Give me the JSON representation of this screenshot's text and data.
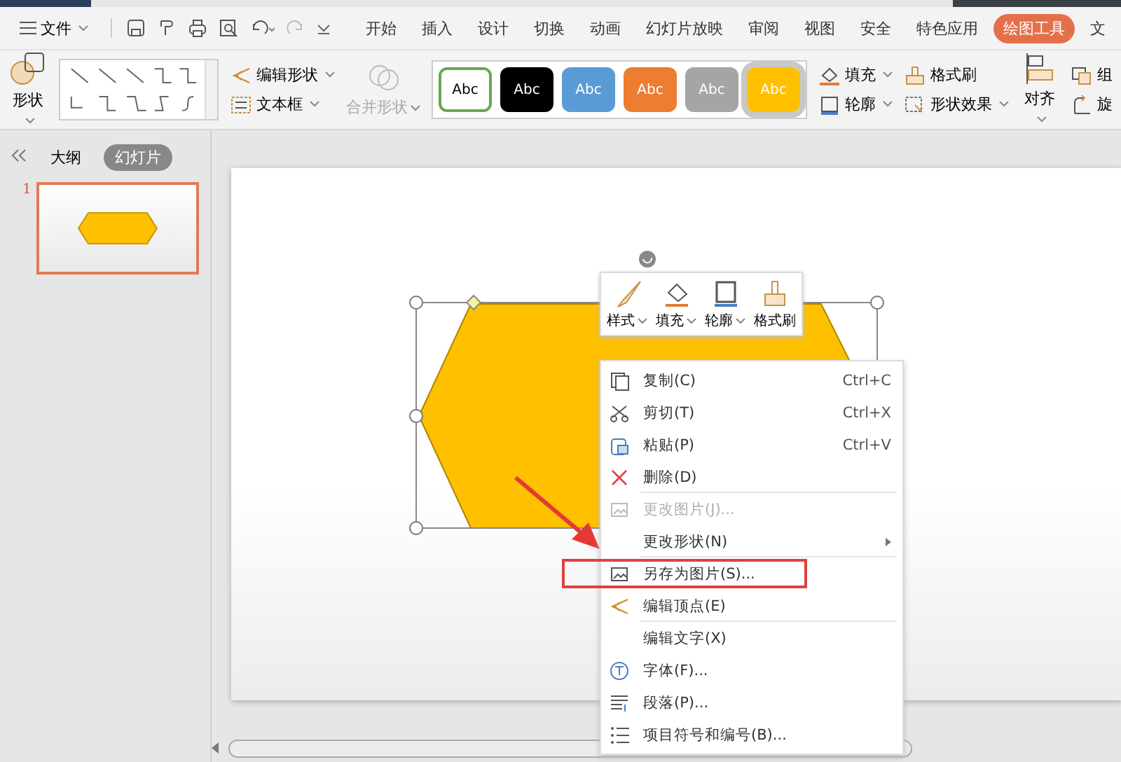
{
  "menu_bar": {
    "file_menu": "文件",
    "tabs": [
      {
        "label": "开始",
        "selected": false
      },
      {
        "label": "插入",
        "selected": false
      },
      {
        "label": "设计",
        "selected": false
      },
      {
        "label": "切换",
        "selected": false
      },
      {
        "label": "动画",
        "selected": false
      },
      {
        "label": "幻灯片放映",
        "selected": false
      },
      {
        "label": "审阅",
        "selected": false
      },
      {
        "label": "视图",
        "selected": false
      },
      {
        "label": "安全",
        "selected": false
      },
      {
        "label": "特色应用",
        "selected": false
      },
      {
        "label": "绘图工具",
        "selected": true
      },
      {
        "label": "文",
        "selected": false
      }
    ]
  },
  "ribbon": {
    "shapes": "形状",
    "edit_shape": "编辑形状",
    "text_box": "文本框",
    "merge_shapes": {
      "label": "合并形状",
      "disabled": true
    },
    "style_presets": [
      {
        "label": "Abc",
        "color": "#ffffff",
        "selected": false
      },
      {
        "label": "Abc",
        "color": "#000000",
        "selected": false
      },
      {
        "label": "Abc",
        "color": "#5b9bd5",
        "selected": false
      },
      {
        "label": "Abc",
        "color": "#ed7d31",
        "selected": false
      },
      {
        "label": "Abc",
        "color": "#a5a5a5",
        "selected": false
      },
      {
        "label": "Abc",
        "color": "#ffc000",
        "selected": true
      }
    ],
    "fill": "填充",
    "format_painter": "格式刷",
    "outline": "轮廓",
    "shape_effects": "形状效果",
    "align": "对齐",
    "group": "组",
    "rotate": "旋"
  },
  "left_pane": {
    "tabs": [
      {
        "label": "大纲",
        "selected": false
      },
      {
        "label": "幻灯片",
        "selected": true
      }
    ],
    "slides": [
      {
        "number": "1",
        "selected": true
      }
    ]
  },
  "mini_toolbar": [
    {
      "label": "样式",
      "has_menu": true
    },
    {
      "label": "填充",
      "has_menu": true
    },
    {
      "label": "轮廓",
      "has_menu": true
    },
    {
      "label": "格式刷",
      "has_menu": false
    }
  ],
  "context_menu": [
    {
      "label": "复制(C)",
      "shortcut": "Ctrl+C",
      "disabled": false,
      "highlighted": false,
      "submenu": false,
      "separator_after": false
    },
    {
      "label": "剪切(T)",
      "shortcut": "Ctrl+X",
      "disabled": false,
      "highlighted": false,
      "submenu": false,
      "separator_after": false
    },
    {
      "label": "粘贴(P)",
      "shortcut": "Ctrl+V",
      "disabled": false,
      "highlighted": false,
      "submenu": false,
      "separator_after": false
    },
    {
      "label": "删除(D)",
      "disabled": false,
      "highlighted": false,
      "submenu": false,
      "separator_after": true
    },
    {
      "label": "更改图片(J)...",
      "disabled": true,
      "highlighted": false,
      "submenu": false,
      "separator_after": false
    },
    {
      "label": "更改形状(N)",
      "disabled": false,
      "highlighted": false,
      "submenu": true,
      "separator_after": true
    },
    {
      "label": "另存为图片(S)...",
      "disabled": false,
      "highlighted": true,
      "submenu": false,
      "separator_after": false
    },
    {
      "label": "编辑顶点(E)",
      "disabled": false,
      "highlighted": false,
      "submenu": false,
      "separator_after": true
    },
    {
      "label": "编辑文字(X)",
      "disabled": false,
      "highlighted": false,
      "submenu": false,
      "separator_after": false
    },
    {
      "label": "字体(F)...",
      "disabled": false,
      "highlighted": false,
      "submenu": false,
      "separator_after": false
    },
    {
      "label": "段落(P)...",
      "disabled": false,
      "highlighted": false,
      "submenu": false,
      "separator_after": false
    },
    {
      "label": "项目符号和编号(B)...",
      "disabled": false,
      "highlighted": false,
      "submenu": false,
      "separator_after": false
    }
  ]
}
